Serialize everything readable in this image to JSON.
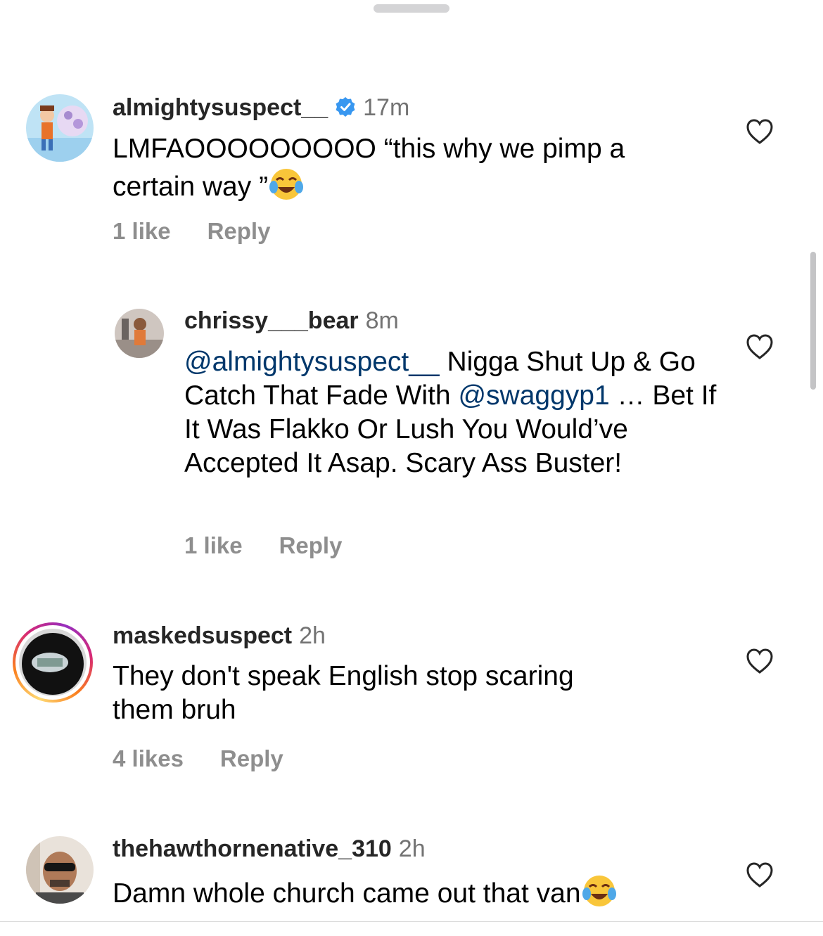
{
  "comments": [
    {
      "username": "almightysuspect__",
      "verified": true,
      "time": "17m",
      "text_line1": "LMFAOOOOOOOOO “this why we pimp a",
      "text_line2": "certain way ”",
      "likes": "1 like",
      "reply": "Reply"
    },
    {
      "username": "chrissy___bear",
      "time": "8m",
      "mention1": "@almightysuspect__",
      "text_part1": " Nigga Shut Up & Go Catch That Fade With ",
      "mention2": "@swaggyp1",
      "text_part2": " … Bet If It Was Flakko Or Lush You Would’ve Accepted It Asap.  Scary Ass Buster!",
      "likes": "1 like",
      "reply": "Reply"
    },
    {
      "username": "maskedsuspect",
      "time": "2h",
      "text_line1": "They don't speak English stop scaring",
      "text_line2": "them bruh",
      "likes": "4 likes",
      "reply": "Reply"
    },
    {
      "username": "thehawthornenative_310",
      "time": "2h",
      "text_line1": "Damn whole church came out that van",
      "likes": "",
      "reply": ""
    }
  ],
  "icons": {
    "like": "heart-outline-icon",
    "verified": "verified-badge-icon",
    "emoji": "face-with-tears-of-joy-emoji"
  },
  "colors": {
    "verified_blue": "#3897f0",
    "mention": "#00376b",
    "secondary_text": "#8e8e8e"
  }
}
